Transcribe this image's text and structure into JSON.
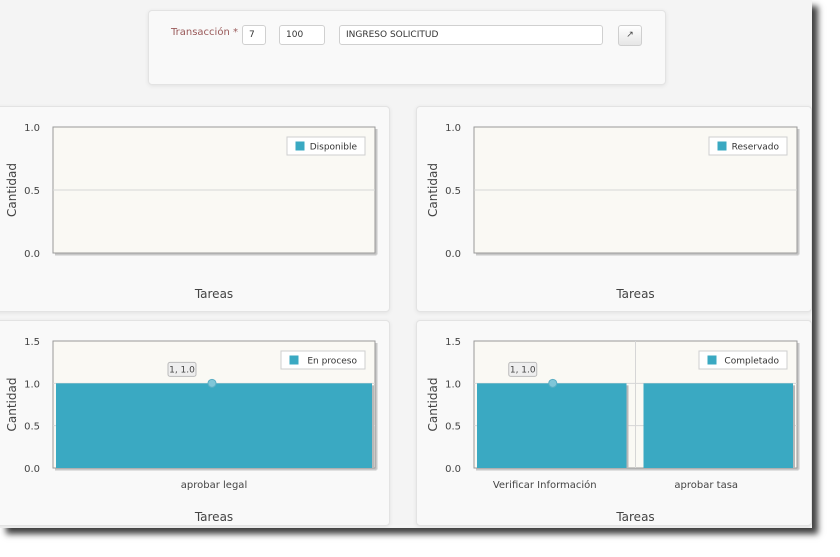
{
  "form": {
    "label": "Transacción *",
    "field_a": "7",
    "field_b": "100",
    "description": "INGRESO SOLICITUD",
    "open_icon": "external-link-icon",
    "open_glyph": "↗"
  },
  "colors": {
    "series": "#3aa9c2",
    "plot_bg": "#faf9f4",
    "grid": "#d6d6d6"
  },
  "chart_data": [
    {
      "type": "bar",
      "ylabel": "Cantidad",
      "xlabel": "Tareas",
      "ylim": [
        0,
        1.0
      ],
      "yticks": [
        "0.0",
        "0.5",
        "1.0"
      ],
      "categories": [],
      "series": [
        {
          "name": "Disponible",
          "values": []
        }
      ],
      "legend": "top-right",
      "tooltip": ""
    },
    {
      "type": "bar",
      "ylabel": "Cantidad",
      "xlabel": "Tareas",
      "ylim": [
        0,
        1.0
      ],
      "yticks": [
        "0.0",
        "0.5",
        "1.0"
      ],
      "categories": [],
      "series": [
        {
          "name": "Reservado",
          "values": []
        }
      ],
      "legend": "top-right",
      "tooltip": ""
    },
    {
      "type": "bar",
      "ylabel": "Cantidad",
      "xlabel": "Tareas",
      "ylim": [
        0,
        1.5
      ],
      "yticks": [
        "0.0",
        "0.5",
        "1.0",
        "1.5"
      ],
      "categories": [
        "aprobar legal"
      ],
      "series": [
        {
          "name": "En proceso",
          "values": [
            1.0
          ]
        }
      ],
      "legend": "top-right",
      "tooltip": "1, 1.0"
    },
    {
      "type": "bar",
      "ylabel": "Cantidad",
      "xlabel": "Tareas",
      "ylim": [
        0,
        1.5
      ],
      "yticks": [
        "0.0",
        "0.5",
        "1.0",
        "1.5"
      ],
      "categories": [
        "Verificar Información",
        "aprobar tasa"
      ],
      "series": [
        {
          "name": "Completado",
          "values": [
            1.0,
            1.0
          ]
        }
      ],
      "legend": "top-right",
      "tooltip": "1, 1.0"
    }
  ]
}
